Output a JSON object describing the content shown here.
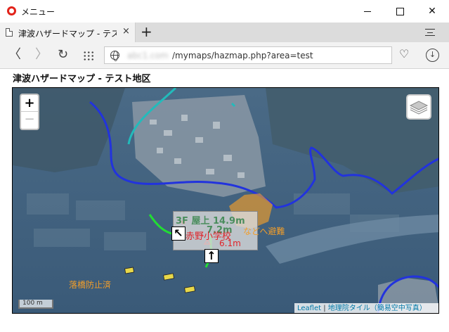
{
  "window": {
    "title": "メニュー"
  },
  "tab": {
    "label": "津波ハザードマップ - テスト地区",
    "close": "×",
    "new": "+"
  },
  "toolbar": {
    "back": "〈",
    "forward": "〉",
    "reload": "↻",
    "url_host": "abc1.com",
    "url_path": "/mymaps/hazmap.php?area=test",
    "heart": "♡",
    "download": "↓"
  },
  "page": {
    "title": "津波ハザードマップ - テスト地区"
  },
  "map": {
    "zoom_in": "+",
    "zoom_out": "−",
    "scale": "100 m",
    "attribution_leaflet": "Leaflet",
    "attribution_sep": " | ",
    "attribution_tiles": "地理院タイル（簡易空中写真）",
    "label_floor": "3F",
    "label_roof_height": "屋上 14.9m",
    "label_height2": "7.2m",
    "label_height3": "6.1m",
    "label_school": "赤野小学校",
    "label_evac": "などへ避難",
    "label_bridge": "落橋防止済",
    "arrow_left": "↖",
    "arrow_up": "↑",
    "colors": {
      "inundation_line": "#2233dd",
      "route_green": "#22dd33",
      "route_cyan": "#22bbbb",
      "zone_orange": "#f29e2a",
      "label_red": "#e0242a",
      "label_green": "#4a8d5d"
    }
  }
}
